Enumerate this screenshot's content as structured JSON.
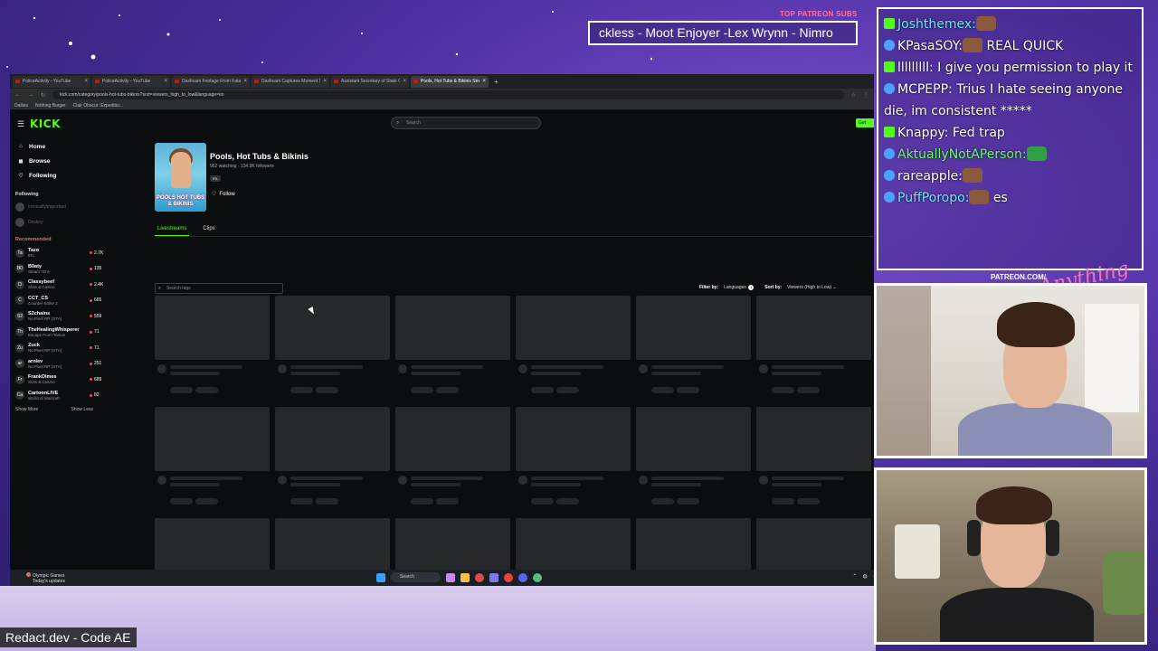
{
  "overlay": {
    "patreon_subs_title": "TOP PATREON SUBS",
    "patreon_subs_ticker": "ckless - Moot Enjoyer -Lex Wrynn - Nimro",
    "patreon_url": "PATREON.COM/",
    "anything_else": "Anything Else",
    "bottom_label": "Redact.dev - Code AE"
  },
  "browser": {
    "tabs": [
      {
        "label": "PoliceActivity - YouTube",
        "active": false
      },
      {
        "label": "PoliceActivity - YouTube",
        "active": false
      },
      {
        "label": "Dashcam Footage From Fatal S",
        "active": false
      },
      {
        "label": "Dashcam Captures Moment S",
        "active": false
      },
      {
        "label": "Assistant Secretary of State Ch",
        "active": false
      },
      {
        "label": "Pools, Hot Tubs & Bikinis Strea",
        "active": true
      }
    ],
    "new_tab": "+",
    "address": "kick.com/category/pools-hot-tubs-bikinis?sort=viewers_high_to_low&language=en",
    "bookmarks": [
      "Dailies",
      "Nothing Burger",
      "Clair Obscur: Expeditio..."
    ]
  },
  "kick": {
    "logo": "KICK",
    "search_placeholder": "Search",
    "get_button": "Get",
    "nav": [
      {
        "label": "Home",
        "icon": "home-icon",
        "glyph": "⌂"
      },
      {
        "label": "Browse",
        "icon": "browse-icon",
        "glyph": "◼"
      },
      {
        "label": "Following",
        "icon": "heart-icon",
        "glyph": "♡"
      }
    ],
    "following_heading": "Following",
    "following": [
      "Ironically/important",
      "Destiny"
    ],
    "recommended_heading": "Recommended",
    "recommended": [
      {
        "initial": "Ta",
        "name": "Tazo",
        "game": "IRL",
        "viewers": "2.7K"
      },
      {
        "initial": "B0",
        "name": "B0aty",
        "game": "Steam TD 6",
        "viewers": "135"
      },
      {
        "initial": "Cl",
        "name": "Classybeef",
        "game": "Slots & Casino",
        "viewers": "2.4K"
      },
      {
        "initial": "C",
        "name": "CCT_CS",
        "game": "Counter-Strike 2",
        "viewers": "665"
      },
      {
        "initial": "S2",
        "name": "S2chains",
        "game": "No Pixel RP (GTA)",
        "viewers": "559"
      },
      {
        "initial": "Th",
        "name": "TheHealingWhisperer",
        "game": "Escape From Tarkov",
        "viewers": "71"
      },
      {
        "initial": "Zu",
        "name": "Zuck",
        "game": "No Pixel RP (GTA)",
        "viewers": "71"
      },
      {
        "initial": "ar",
        "name": "arnlev",
        "game": "No Pixel RP (GTA)",
        "viewers": "251"
      },
      {
        "initial": "Fr",
        "name": "FrankDimes",
        "game": "Slots & Casino",
        "viewers": "689"
      },
      {
        "initial": "Ca",
        "name": "CartoonLIVE",
        "game": "World of Warcraft",
        "viewers": "82"
      }
    ],
    "show_more": "Show More",
    "show_less": "Show Less",
    "category": {
      "title": "Pools, Hot Tubs & Bikinis",
      "stats": "962 watching · 134.9K followers",
      "tag": "IRL",
      "image_text": "POOLS HOT TUBS & BIKINIS",
      "follow_label": "Follow"
    },
    "tabs": [
      {
        "label": "Livestreams",
        "active": true
      },
      {
        "label": "Clips",
        "active": false
      }
    ],
    "tags_placeholder": "Search tags",
    "filters": {
      "filter_by": "Filter by:",
      "languages": "Languages",
      "languages_count": "1",
      "sort_by": "Sort by:",
      "sort_value": "Viewers (High to Low)"
    }
  },
  "taskbar": {
    "news_title": "Olympic Games",
    "news_sub": "Today's updates",
    "search": "Search"
  },
  "chat": [
    {
      "user": "Joshthemex:",
      "text": "",
      "style": "u",
      "prefix": "k",
      "emote": "brown"
    },
    {
      "user": "KPasaSOY:",
      "text": " REAL QUICK",
      "style": "u white",
      "prefix": "c",
      "emote": "brown"
    },
    {
      "user": "lllllllll:",
      "text": " I give you permission to play it",
      "style": "u white",
      "prefix": "k",
      "emote": ""
    },
    {
      "user": "MCPEPP:",
      "text": " Trius I hate seeing anyone die, im consistent *****",
      "style": "u white",
      "prefix": "c",
      "emote": ""
    },
    {
      "user": "Knappy:",
      "text": " Fed trap",
      "style": "u white",
      "prefix": "k",
      "emote": ""
    },
    {
      "user": "AktuallyNotAPerson:",
      "text": "",
      "style": "u green",
      "prefix": "c",
      "emote": "green"
    },
    {
      "user": "rareapple:",
      "text": "",
      "style": "u white",
      "prefix": "c",
      "emote": "brown"
    },
    {
      "user": "PuffPoropo:",
      "text": " es",
      "style": "u",
      "prefix": "c",
      "emote": "brown"
    }
  ]
}
